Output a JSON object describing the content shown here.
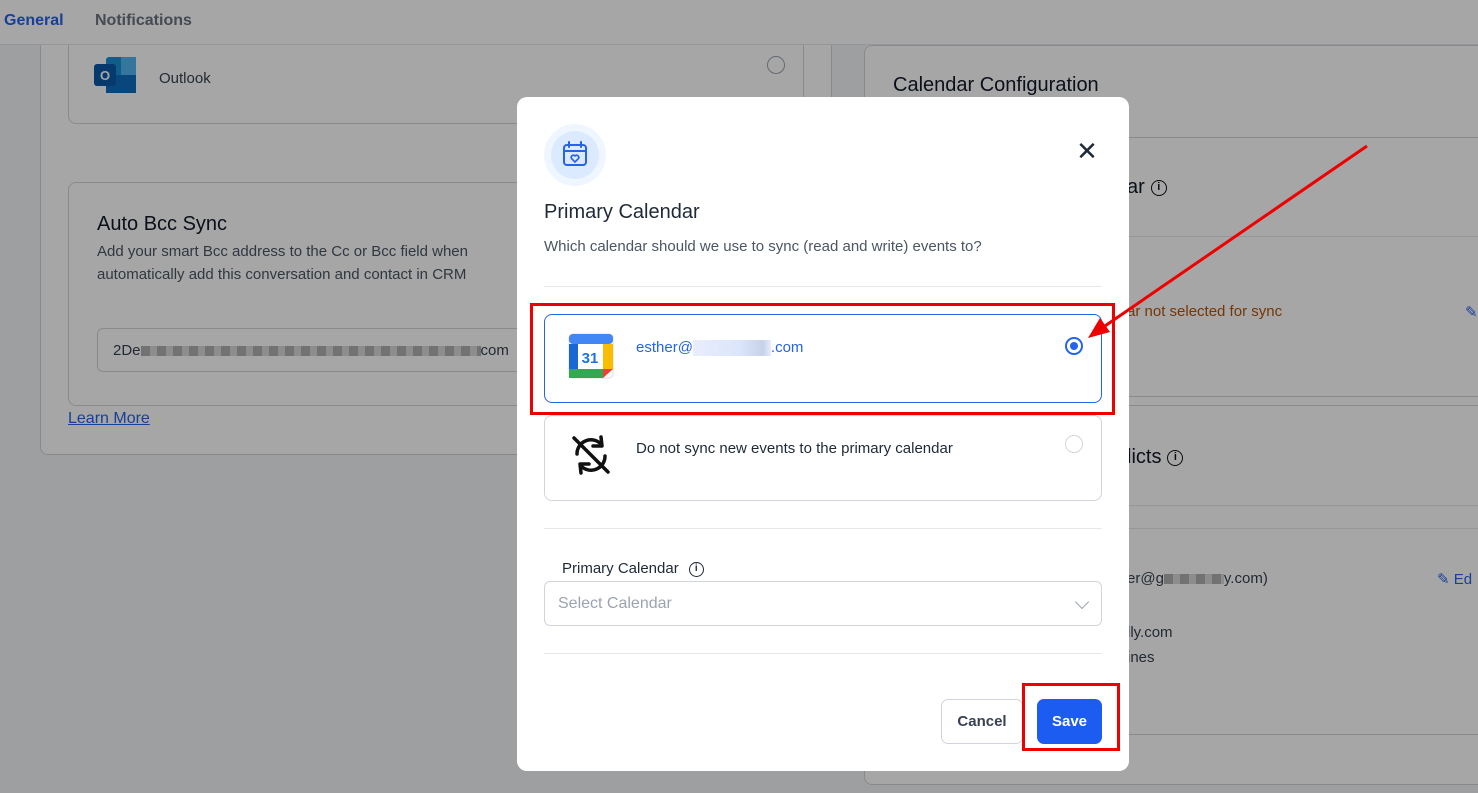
{
  "tabs": {
    "general": "General",
    "notifications": "Notifications"
  },
  "background": {
    "outlook_label": "Outlook",
    "bcc_title": "Auto Bcc Sync",
    "bcc_description_line1": "Add your smart Bcc address to the Cc or Bcc field when",
    "bcc_description_line2": "automatically add this conversation and contact in CRM",
    "bcc_value_prefix": "2De",
    "bcc_value_suffix": "com",
    "learn_more": "Learn More",
    "calendar_configuration": "Calendar Configuration",
    "right_title_partial": "ar",
    "not_selected_partial": "ar not selected for sync",
    "conflicts_partial": "licts",
    "email_partial_prefix": "er@g",
    "email_partial_suffix": "y.com)",
    "edit_partial": "Ed",
    "domain_partial": "lly.com",
    "lines_partial": "ines"
  },
  "modal": {
    "title": "Primary Calendar",
    "subtitle": "Which calendar should we use to sync (read and write) events to?",
    "options": [
      {
        "email_prefix": "esther@",
        "email_suffix": ".com",
        "icon": "google-calendar-icon",
        "selected": true
      },
      {
        "label": "Do not sync new events to the primary calendar",
        "icon": "sync-off-icon",
        "selected": false
      }
    ],
    "field_label": "Primary Calendar",
    "select_placeholder": "Select Calendar",
    "cancel": "Cancel",
    "save": "Save"
  },
  "colors": {
    "accent": "#2563eb",
    "save_button": "#1d5cf0",
    "annotation": "#ee0000"
  }
}
